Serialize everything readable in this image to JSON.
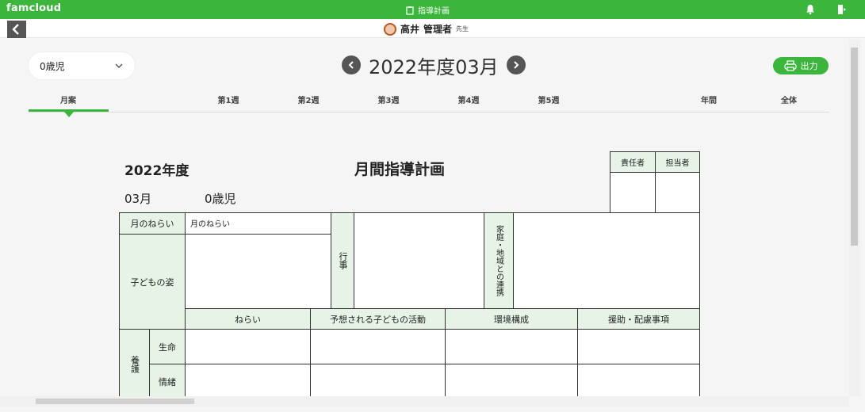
{
  "topbar": {
    "brand": "famcloud",
    "app_name": "指導計画"
  },
  "user": {
    "name": "高井",
    "role": "管理者",
    "honorific": "先生"
  },
  "filters": {
    "age_value": "0歳児"
  },
  "period": {
    "label": "2022年度03月"
  },
  "actions": {
    "print_label": "出力"
  },
  "tabs": [
    "月案",
    "第1週",
    "第2週",
    "第3週",
    "第4週",
    "第5週",
    "年間",
    "全体"
  ],
  "document": {
    "year": "2022年度",
    "title": "月間指導計画",
    "month": "03月",
    "age": "0歳児",
    "signers": {
      "responsible": "責任者",
      "in_charge": "担当者"
    },
    "rows": {
      "monthly_aim": "月のねらい",
      "monthly_aim_value": "月のねらい",
      "child_state": "子どもの姿",
      "events": "行事",
      "family_community": "家庭・地域との連携"
    },
    "columns": {
      "aim": "ねらい",
      "expected_activities": "予想される子どもの活動",
      "environment": "環境構成",
      "support": "援助・配慮事項"
    },
    "care": {
      "group": "養護",
      "life": "生命",
      "emotion": "情緒"
    }
  },
  "colors": {
    "accent": "#3bb53b",
    "header_cell": "#e6f3e6"
  }
}
